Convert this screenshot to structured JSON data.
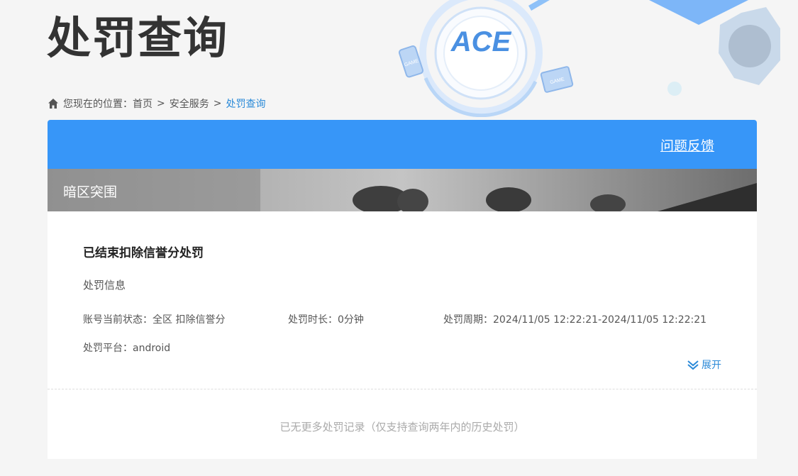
{
  "header": {
    "title": "处罚查询"
  },
  "breadcrumb": {
    "prefix": "您现在的位置：",
    "items": [
      "首页",
      "安全服务",
      "处罚查询"
    ]
  },
  "panel": {
    "feedback_label": "问题反馈",
    "game_name": "暗区突围",
    "accent": "#3796f8"
  },
  "record": {
    "title": "已结束扣除信誉分处罚",
    "section_label": "处罚信息",
    "status": "账号当前状态：全区 扣除信誉分",
    "duration": "处罚时长：0分钟",
    "period": "处罚周期：2024/11/05 12:22:21-2024/11/05 12:22:21",
    "platform": "处罚平台：android",
    "expand_label": "展开"
  },
  "footer": {
    "no_more": "已无更多处罚记录（仅支持查询两年内的历史处罚）"
  },
  "logo": {
    "text": "ACE",
    "device_label_1": "GAME",
    "device_label_2": "GAME"
  }
}
